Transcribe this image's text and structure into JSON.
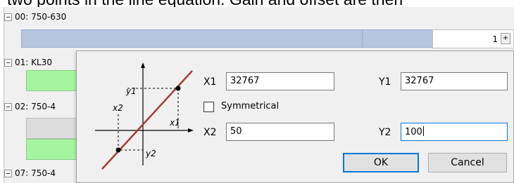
{
  "heading_fragment": "two points in the line equation. Gain and offset are then",
  "tree": {
    "groups": [
      {
        "label": "00: 750-630"
      },
      {
        "label": "01: KL30"
      },
      {
        "label": "02: 750-4"
      },
      {
        "label": "07: 750-4"
      }
    ],
    "spin_value": "1",
    "spin_icon": "spin-plus-icon"
  },
  "dialog": {
    "graph_labels": {
      "y1": "y1",
      "x2": "x2",
      "x1": "x1",
      "y2": "y2"
    },
    "x1_label": "X1",
    "x1_value": "32767",
    "y1_label": "Y1",
    "y1_value": "32767",
    "symmetrical_label": "Symmetrical",
    "symmetrical_checked": false,
    "x2_label": "X2",
    "x2_value": "50",
    "y2_label": "Y2",
    "y2_value": "100",
    "ok_label": "OK",
    "cancel_label": "Cancel"
  },
  "colors": {
    "line": "#a83c32",
    "bar_blue": "#b6c6e0",
    "bar_green": "#a5f5a0",
    "focus": "#0078d7"
  }
}
